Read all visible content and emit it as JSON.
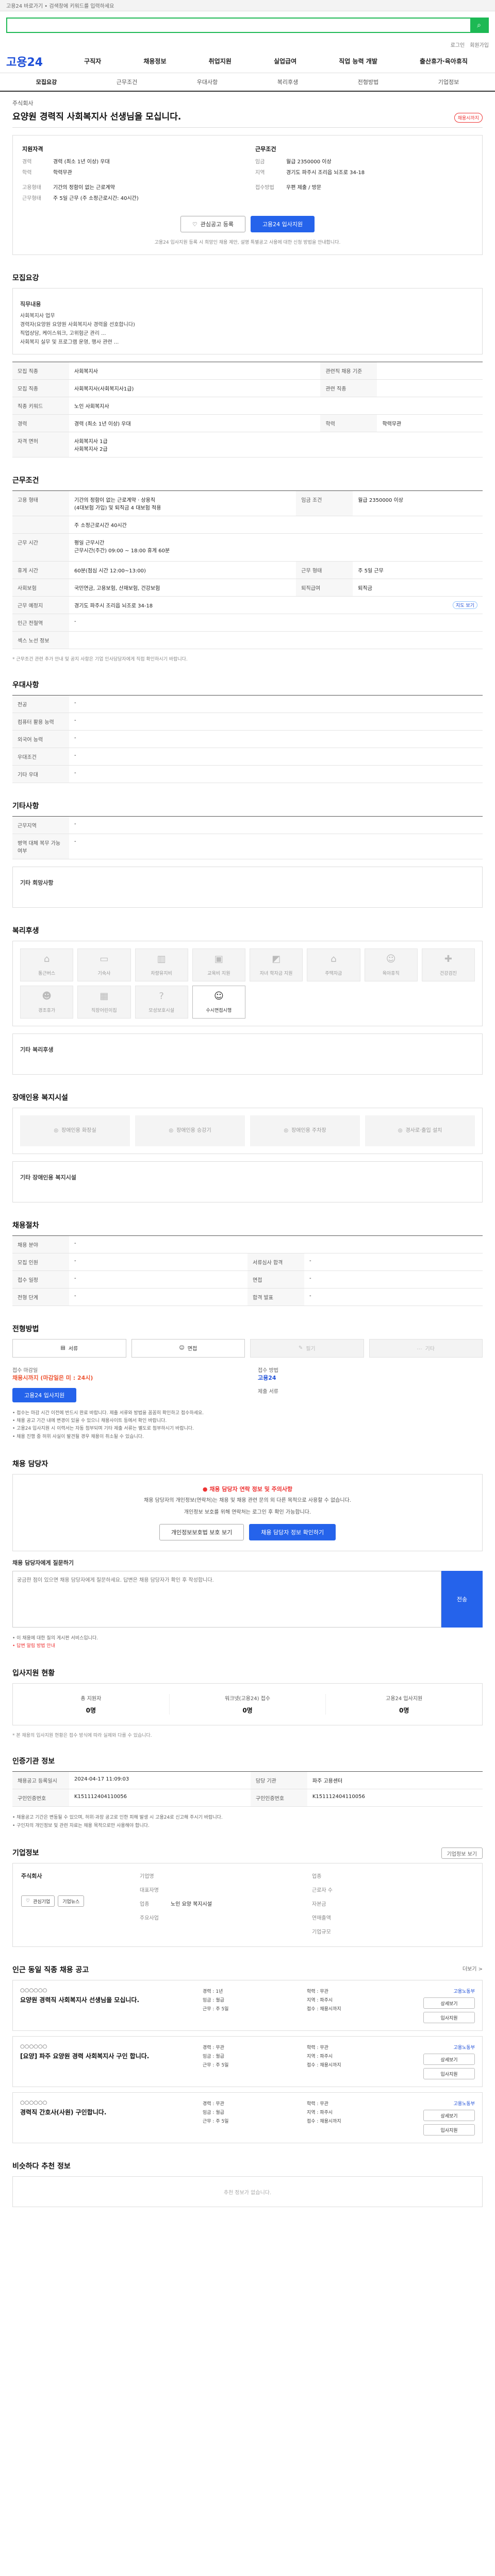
{
  "util": {
    "text": "고용24 바로가기 • 검색창에 키워드를 입력하세요"
  },
  "search": {
    "placeholder": ""
  },
  "top_links": {
    "login": "로그인",
    "join": "회원가입"
  },
  "gnb": {
    "logo": "고용24",
    "menu": [
      "구직자",
      "채용정보",
      "취업지원",
      "실업급여",
      "직업 능력 개발",
      "출산휴가·육아휴직"
    ]
  },
  "tabs": [
    "모집요강",
    "근무조건",
    "우대사항",
    "복리후생",
    "전형방법",
    "기업정보"
  ],
  "job": {
    "company": "주식회사",
    "title": "요양원 경력직 사회복지사 선생님을 모십니다.",
    "badge": "채용시까지"
  },
  "summary": {
    "h1": "지원자격",
    "h2": "근무조건",
    "rows_left": [
      {
        "k": "경력",
        "v": "경력 (최소 1년 이상) 우대"
      },
      {
        "k": "학력",
        "v": "학력무관"
      },
      {
        "k": "고용형태",
        "v": ""
      },
      {
        "k": "고용형태",
        "v": "기간의 정함이 없는 근로계약"
      },
      {
        "k": "근무형태",
        "v": "주 5일 근무 (주 소정근로시간: 40시간)"
      }
    ],
    "rows_right": [
      {
        "k": "임금",
        "v": "월급 2350000 이상"
      },
      {
        "k": "지역",
        "v": "경기도 파주시 조리읍 뇌조로 34-18"
      },
      {
        "k": "",
        "v": ""
      },
      {
        "k": "접수방법",
        "v": ""
      },
      {
        "k": "",
        "v": "우편 제출 / 방문"
      }
    ],
    "btn_interest": "관심공고 등록",
    "btn_apply": "고용24 입사지원",
    "note": "고용24 입사지원 등록 시 희망인 채용 제안, 설명 특별공고 사용에 대한 신청 방법을 안내합니다."
  },
  "recruit": {
    "title": "모집요강",
    "sub1": "직무내용",
    "desc": "사회복지사 업무\n경력자(요양원 요양원 사회복지사 경력을 선호합니다)\n직업상담, 케이스워크, 고위험군 관리 ...\n사회복지 실무 및 프로그램 운영, 행사 관련 ...",
    "rows": [
      {
        "k": "모집 직종",
        "v": "사회복지사",
        "k2": "관련직 채용 기준",
        "v2": ""
      },
      {
        "k": "모집 직종",
        "v": "사회복지사(사회복지사1급)",
        "k2": "관련 직종",
        "v2": ""
      },
      {
        "k": "직종 키워드",
        "v": "노인 사회복지사",
        "k2": "",
        "v2": ""
      },
      {
        "k": "경력",
        "v": "경력 (최소 1년 이상) 우대",
        "k2": "학력",
        "v2": "학력무관"
      },
      {
        "k": "자격 면허",
        "v": "사회복지사 1급\n사회복지사 2급",
        "k2": "",
        "v2": ""
      }
    ]
  },
  "condition": {
    "title": "근무조건",
    "rows": [
      {
        "k": "고용 형태",
        "v": "기간의 정함이 없는 근로계약 · 상용직\n(4대보험 가입) 및 퇴직금 4 대보험 적용",
        "k2": "임금 조건",
        "v2": "월급 2350000 이상"
      },
      {
        "k": "",
        "v": "주 소정근로시간 40시간",
        "k2": "",
        "v2": ""
      },
      {
        "k": "근무 시간",
        "v": "평일 근무시간\n근무시간(주간) 09:00 ~ 18:00 휴게 60분",
        "k2": "",
        "v2": ""
      },
      {
        "k": "휴게 시간",
        "v": "60분(점심 시간 12:00~13:00)",
        "k2": "근무 형태",
        "v2": "주 5일 근무"
      },
      {
        "k": "사회보험",
        "v": "국민연금, 고용보험, 산재보험, 건강보험",
        "k2": "퇴직급여",
        "v2": "퇴직금"
      },
      {
        "k": "근무 예정지",
        "v": "경기도 파주시 조리읍 뇌조로 34-18",
        "k2": "",
        "v2": "지도 보기"
      },
      {
        "k": "인근 전철역",
        "v": "-",
        "k2": "",
        "v2": ""
      },
      {
        "k": "섹스 노선 정보",
        "v": "",
        "k2": "",
        "v2": ""
      }
    ],
    "note": "* 근무조건 관련 추가 안내 및 공지 사항은 기업 인사담당자에게 직접 확인하시기 바랍니다."
  },
  "pref": {
    "title": "우대사항",
    "rows": [
      {
        "k": "전공",
        "v": "-"
      },
      {
        "k": "컴퓨터 활용 능력",
        "v": "-"
      },
      {
        "k": "외국어 능력",
        "v": "-"
      },
      {
        "k": "우대조건",
        "v": "-"
      },
      {
        "k": "기타 우대",
        "v": "-"
      }
    ]
  },
  "etc": {
    "title": "기타사항",
    "rows": [
      {
        "k": "근무지역",
        "v": "-"
      },
      {
        "k": "병역 대체 복무 가능 여부",
        "v": "-"
      }
    ],
    "sub": "기타 회망사항"
  },
  "welfare": {
    "title": "복리후생",
    "items": [
      {
        "icon": "home-icon",
        "glyph": "⌂",
        "label": "통근버스",
        "on": false
      },
      {
        "icon": "bed-icon",
        "glyph": "▭",
        "label": "기숙사",
        "on": false
      },
      {
        "icon": "meal-icon",
        "glyph": "▥",
        "label": "차량유지비",
        "on": false
      },
      {
        "icon": "gift-icon",
        "glyph": "▣",
        "label": "교육비 지원",
        "on": false
      },
      {
        "icon": "cap-icon",
        "glyph": "◩",
        "label": "자녀 학자금 지원",
        "on": false
      },
      {
        "icon": "house-icon",
        "glyph": "⌂",
        "label": "주택자금",
        "on": false
      },
      {
        "icon": "baby-icon",
        "glyph": "☺",
        "label": "육아휴직",
        "on": false
      },
      {
        "icon": "medical-icon",
        "glyph": "✚",
        "label": "건강검진",
        "on": false
      },
      {
        "icon": "child-icon",
        "glyph": "☻",
        "label": "경조휴가",
        "on": false
      },
      {
        "icon": "building-icon",
        "glyph": "▦",
        "label": "직장어린이집",
        "on": false
      },
      {
        "icon": "question-icon",
        "glyph": "?",
        "label": "모성보호시설",
        "on": false
      },
      {
        "icon": "person-icon",
        "glyph": "☺",
        "label": "수시면접시행",
        "on": true
      }
    ],
    "other_label": "기타 복리후생"
  },
  "disabled": {
    "title": "장애인용 복지시설",
    "items": [
      "장애인용 화장실",
      "장애인용 승강기",
      "장애인용 주차장",
      "경사로·출입 설치"
    ],
    "other_label": "기타 장애인용 복지시설"
  },
  "process": {
    "title": "채용절차",
    "rows": [
      {
        "k": "채용 분야",
        "v": "-",
        "k2": "",
        "v2": ""
      },
      {
        "k": "모집 인원",
        "v": "-",
        "k2": "서류심사 합격",
        "v2": "-"
      },
      {
        "k": "접수 일정",
        "v": "-",
        "k2": "면접",
        "v2": "-"
      },
      {
        "k": "전형 단계",
        "v": "-",
        "k2": "합격 발표",
        "v2": "-"
      }
    ]
  },
  "method": {
    "title": "전형방법",
    "items": [
      {
        "label": "서류",
        "icon": "document-icon",
        "glyph": "▤",
        "off": false
      },
      {
        "label": "면접",
        "icon": "interview-icon",
        "glyph": "☺",
        "off": false
      },
      {
        "label": "필기",
        "icon": "pen-icon",
        "glyph": "✎",
        "off": true
      },
      {
        "label": "기타",
        "icon": "more-icon",
        "glyph": "…",
        "off": true
      }
    ],
    "apply_lbl1": "접수 마감일",
    "apply_val1": "채용시까지 (마감일은 미 : 24시)",
    "apply_lbl2": "접수 방법",
    "apply_val2": "고용24",
    "apply_lbl3": "제출 서류",
    "apply_val3": "",
    "apply_btn": "고용24 입사지원",
    "bullets": [
      "• 접수는 마감 시간 이전에 반드시 완료 바랍니다. 제출 서류와 방법을 꼼꼼히 확인하고 접수하세요.",
      "• 채용 공고 기간 내에 변경이 있을 수 있으니 채용사이트 등에서 확인 바랍니다.",
      "• 고용24 입사지원 시 이력서는 자동 첨부되며 기타 제출 서류는 별도로 첨부하시기 바랍니다.",
      "• 채용 진행 중 허위 사실이 발견될 경우 채용이 취소될 수 있습니다."
    ]
  },
  "manager": {
    "title": "채용 담당자",
    "warn": "채용 담당자 연락 정보 및 주의사항",
    "text1": "채용 담당자의 개인정보(연락처)는 채용 및 채용 관련 문의 외 다른 목적으로 사용할 수 없습니다.",
    "text2": "개인정보 보호를 위해 연락처는 로그인 후 확인 가능합니다.",
    "btn_login": "개인정보보호법 보호 보기",
    "btn_view": "채용 담당자 정보 확인하기",
    "qa_title": "채용 담당자에게 질문하기",
    "qa_placeholder": "궁금한 점이 있으면 채용 담당자에게 질문하세요. 답변은 채용 담당자가 확인 후 작성합니다.",
    "qa_btn": "전송",
    "qa_note1": "• 이 채용에 대한 질의 게시판 서비스입니다.",
    "qa_note2": "• 답변 알림 방법 안내"
  },
  "stats": {
    "title": "입사지원 현황",
    "items": [
      {
        "t": "총 지원자",
        "n": "0명"
      },
      {
        "t": "워크넷(고용24) 접수",
        "n": "0명"
      },
      {
        "t": "고용24 입사지원",
        "n": "0명"
      }
    ],
    "note": "* 본 채용의 입사지원 현황은 접수 방식에 따라 실제와 다를 수 있습니다."
  },
  "reg": {
    "title": "인증기관 정보",
    "rows": [
      {
        "k": "채용공고 등록일시",
        "v": "2024-04-17 11:09:03",
        "k2": "담당 기관",
        "v2": "파주 고용센터"
      },
      {
        "k": "구인인증번호",
        "v": "K151112404110056",
        "k2": "구인인증번호",
        "v2": "K151112404110056"
      }
    ],
    "bullets": [
      "• 채용공고 기간은 변동될 수 있으며, 허위·과장 공고로 인한 피해 발생 시 고용24로 신고해 주시기 바랍니다.",
      "• 구인자의 개인정보 및 관련 자료는 채용 목적으로만 사용해야 합니다."
    ]
  },
  "company": {
    "title": "기업정보",
    "name": "주식회사",
    "btn": "기업정보 보기",
    "btn1": "관심기업",
    "btn2": "기업뉴스",
    "rows": [
      {
        "k": "기업명",
        "v": "",
        "k2": "업종",
        "v2": ""
      },
      {
        "k": "대표자명",
        "v": "",
        "k2": "근로자 수",
        "v2": ""
      },
      {
        "k": "업종",
        "v": "노인 요양 복지시설",
        "k2": "자본금",
        "v2": ""
      },
      {
        "k": "주요사업",
        "v": "",
        "k2": "연매출액",
        "v2": ""
      },
      {
        "k": "",
        "v": "",
        "k2": "기업규모",
        "v2": ""
      }
    ]
  },
  "related": {
    "title": "인근 동일 직종 채용 공고",
    "more": "더보기 >",
    "items": [
      {
        "co": "○○○○○○",
        "title": "요양원 경력직 사회복지사 선생님을 모십니다.",
        "meta": [
          "경력 : 1년",
          "학력 : 무관",
          "임금 : 월급",
          "지역 : 파주시",
          "근무 : 주 5일",
          "접수 : 채용시까지"
        ],
        "agency": "고용노동부"
      },
      {
        "co": "○○○○○○",
        "title": "[요양] 파주 요양원 경력 사회복지사 구인 합니다.",
        "meta": [
          "경력 : 무관",
          "학력 : 무관",
          "임금 : 월급",
          "지역 : 파주시",
          "근무 : 주 5일",
          "접수 : 채용시까지"
        ],
        "agency": "고용노동부"
      },
      {
        "co": "○○○○○○",
        "title": "경력직 간호사(사원) 구인합니다.",
        "meta": [
          "경력 : 무관",
          "학력 : 무관",
          "임금 : 월급",
          "지역 : 파주시",
          "근무 : 주 5일",
          "접수 : 채용시까지"
        ],
        "agency": "고용노동부"
      }
    ],
    "btn_detail": "상세보기",
    "btn_apply": "입사지원"
  },
  "recent": {
    "title": "비슷하다 추천 정보",
    "empty": "추천 정보가 없습니다."
  }
}
